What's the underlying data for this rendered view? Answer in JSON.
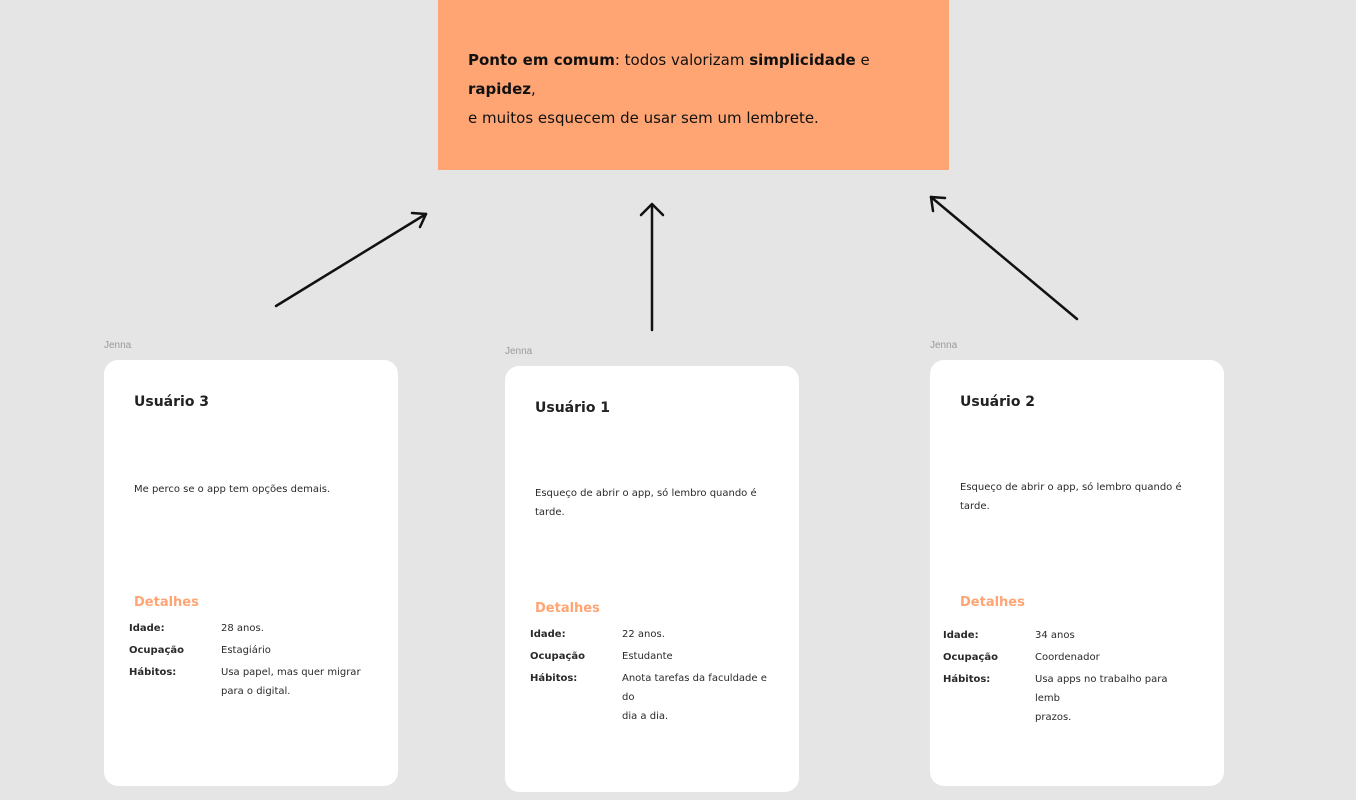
{
  "summary": {
    "line1_bold1": "Ponto em comum",
    "line1_text1": ": todos valorizam ",
    "line1_bold2": "simplicidade",
    "line1_text2": " e ",
    "line1_bold3": "rapidez",
    "line1_text3": ",",
    "line2": "e muitos esquecem de usar sem um lembrete."
  },
  "colors": {
    "accent": "#ffa574",
    "canvas": "#e5e5e5",
    "card": "#ffffff"
  },
  "cards": [
    {
      "frame_label": "Jenna",
      "title": "Usuário 3",
      "quote": "Me perco se o app tem opções demais.",
      "details_title": "Detalhes",
      "rows": [
        {
          "label": "Idade:",
          "value": "28 anos."
        },
        {
          "label": "Ocupação",
          "value": "Estagiário"
        },
        {
          "label": "Hábitos:",
          "value": "Usa papel, mas quer migrar\npara o digital."
        }
      ]
    },
    {
      "frame_label": "Jenna",
      "title": "Usuário 1",
      "quote": "Esqueço de abrir o app, só lembro quando é tarde.",
      "details_title": "Detalhes",
      "rows": [
        {
          "label": "Idade:",
          "value": "22 anos."
        },
        {
          "label": "Ocupação",
          "value": "Estudante"
        },
        {
          "label": "Hábitos:",
          "value": "Anota tarefas da faculdade e do\n dia a dia."
        }
      ]
    },
    {
      "frame_label": "Jenna",
      "title": "Usuário 2",
      "quote": "Esqueço de abrir o app, só lembro quando é tarde.",
      "details_title": "Detalhes",
      "rows": [
        {
          "label": "Idade:",
          "value": "34 anos"
        },
        {
          "label": "Ocupação",
          "value": "Coordenador"
        },
        {
          "label": "Hábitos:",
          "value": "Usa apps no trabalho para lemb\n prazos."
        }
      ]
    }
  ]
}
